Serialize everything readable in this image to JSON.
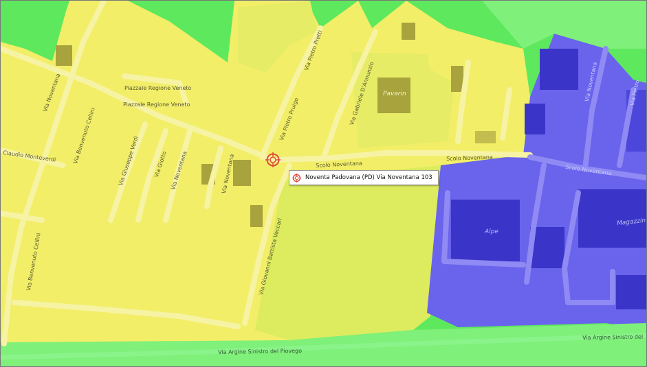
{
  "map": {
    "zone_colors": {
      "green": "#5ee85e",
      "green_light": "#7ff07a",
      "yellow": "#f2ee68",
      "yellow_green": "#dcec5e",
      "blue": "#6a63ec",
      "road_yellow": "#f7f3a4",
      "road_blue": "#8f8af4",
      "road_green": "#8af38a",
      "building_yellow": "#a8a33c",
      "building_blue": "#3a34c8"
    },
    "street_labels": {
      "piazzale_regione_veneto_1": "Piazzale Regione Veneto",
      "piazzale_regione_veneto_2": "Piazzale Regione Veneto",
      "via_noventana_north": "Via Noventana",
      "via_benvenuto_cellini_north": "Via Benvenuto Cellini",
      "claudio_monteverdi": "Claudio Monteverdi",
      "via_giuseppe_verdi": "Via Giuseppe Verdi",
      "via_giotto": "Via Giotto",
      "via_noventana_mid": "Via Noventana",
      "via_noventana_south": "Via Noventana",
      "via_pietro_pretti": "Via Pietro Pretti",
      "via_pietro_pruigo": "Via Pietro Pruigo",
      "via_gabriele_dannunzio": "Via Gabriele D'Annunzio",
      "scolo_noventana_1": "Scolo Noventana",
      "scolo_noventana_2": "Scolo Noventana",
      "scolo_noventana_3": "Scolo Noventana",
      "via_noventana_east": "Via Noventana",
      "via_pietro_nord": "Via Pietro",
      "via_benvenuto_cellini_south": "Via Benvenuto Cellini",
      "via_giovanni_battista_vaccari": "Via Giovanni Battista Vaccari",
      "via_argine_sinistro_del_piovego_1": "Via Argine Sinistro del Piovego",
      "via_argine_sinistro_del_piovego_2": "Via Argine Sinistro del"
    },
    "poi_labels": {
      "pavarin": "Pavarin",
      "alpe": "Alpe",
      "magazzini": "Magazzin"
    },
    "marker": {
      "icon": "crosshair-target-icon",
      "color": "#e04a3a"
    },
    "tooltip": {
      "icon": "crosshair-target-icon",
      "text": "Noventa Padovana (PD) Via Noventana 103"
    }
  }
}
